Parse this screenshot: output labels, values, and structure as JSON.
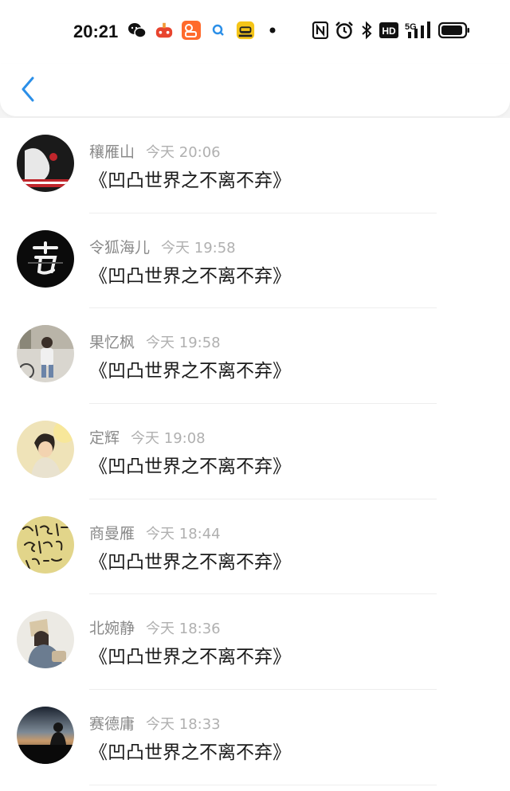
{
  "status_bar": {
    "time": "20:21",
    "network": "5G",
    "hd_badge": "HD",
    "app_icons": [
      "wechat-icon",
      "game-controller-icon",
      "video-app-icon",
      "search-app-icon",
      "taxi-app-icon",
      "dot-icon"
    ],
    "system_icons": [
      "nfc-icon",
      "alarm-icon",
      "bluetooth-icon",
      "hd-icon",
      "signal-5g-icon",
      "battery-icon"
    ]
  },
  "nav": {
    "back_icon": "chevron-left-icon",
    "accent_color": "#2b8fe8"
  },
  "comments": [
    {
      "user": "穰雁山",
      "time": "今天 20:06",
      "text": "《凹凸世界之不离不弃》"
    },
    {
      "user": "令狐海儿",
      "time": "今天 19:58",
      "text": "《凹凸世界之不离不弃》"
    },
    {
      "user": "果忆枫",
      "time": "今天 19:58",
      "text": "《凹凸世界之不离不弃》"
    },
    {
      "user": "定辉",
      "time": "今天 19:08",
      "text": "《凹凸世界之不离不弃》"
    },
    {
      "user": "商曼雁",
      "time": "今天 18:44",
      "text": "《凹凸世界之不离不弃》"
    },
    {
      "user": "北婉静",
      "time": "今天 18:36",
      "text": "《凹凸世界之不离不弃》"
    },
    {
      "user": "赛德庸",
      "time": "今天 18:33",
      "text": "《凹凸世界之不离不弃》"
    }
  ]
}
